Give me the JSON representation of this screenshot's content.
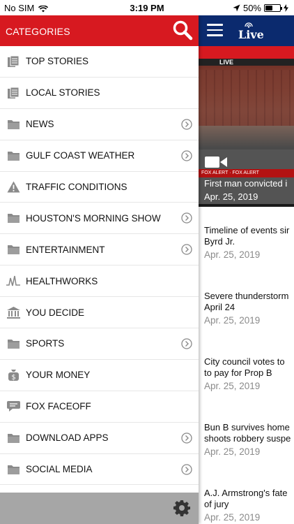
{
  "status_bar": {
    "carrier": "No SIM",
    "time": "3:19 PM",
    "battery": "50%",
    "battery_level": 0.5
  },
  "drawer": {
    "title": "CATEGORIES",
    "items": [
      {
        "label": "TOP STORIES",
        "icon": "document-icon",
        "has_chevron": false
      },
      {
        "label": "LOCAL STORIES",
        "icon": "document-icon",
        "has_chevron": false
      },
      {
        "label": "NEWS",
        "icon": "folder-icon",
        "has_chevron": true
      },
      {
        "label": "GULF COAST WEATHER",
        "icon": "folder-icon",
        "has_chevron": true
      },
      {
        "label": "TRAFFIC CONDITIONS",
        "icon": "warning-icon",
        "has_chevron": false
      },
      {
        "label": "HOUSTON'S MORNING SHOW",
        "icon": "folder-icon",
        "has_chevron": true
      },
      {
        "label": "ENTERTAINMENT",
        "icon": "folder-icon",
        "has_chevron": true
      },
      {
        "label": "HEALTHWORKS",
        "icon": "heartbeat-icon",
        "has_chevron": false
      },
      {
        "label": "YOU DECIDE",
        "icon": "capitol-icon",
        "has_chevron": false
      },
      {
        "label": "SPORTS",
        "icon": "folder-icon",
        "has_chevron": true
      },
      {
        "label": "YOUR MONEY",
        "icon": "money-bag-icon",
        "has_chevron": false
      },
      {
        "label": "FOX FACEOFF",
        "icon": "speech-bubble-icon",
        "has_chevron": false
      },
      {
        "label": "DOWNLOAD APPS",
        "icon": "folder-icon",
        "has_chevron": true
      },
      {
        "label": "SOCIAL MEDIA",
        "icon": "folder-icon",
        "has_chevron": true
      }
    ]
  },
  "app": {
    "logo_text": "Live",
    "hero": {
      "live_tag": "LIVE",
      "ticker": "FOX ALERT · FOX ALERT",
      "headline": "First man convicted i",
      "date": "Apr. 25, 2019"
    },
    "stories": [
      {
        "title_line1": "Timeline of events sir",
        "title_line2": "Byrd Jr.",
        "date": "Apr. 25, 2019"
      },
      {
        "title_line1": "Severe thunderstorm",
        "title_line2": "April 24",
        "date": "Apr. 25, 2019"
      },
      {
        "title_line1": "City council votes to",
        "title_line2": "to pay for Prop B",
        "date": "Apr. 25, 2019"
      },
      {
        "title_line1": "Bun B survives home",
        "title_line2": "shoots robbery suspe",
        "date": "Apr. 25, 2019"
      },
      {
        "title_line1": "A.J. Armstrong's fate",
        "title_line2": "of jury",
        "date": "Apr. 25, 2019"
      }
    ]
  },
  "colors": {
    "drawer_header": "#d71920",
    "app_bar": "#0b2a6e",
    "footer": "#a6a6a6",
    "icon_gray": "#8a8a8a"
  }
}
